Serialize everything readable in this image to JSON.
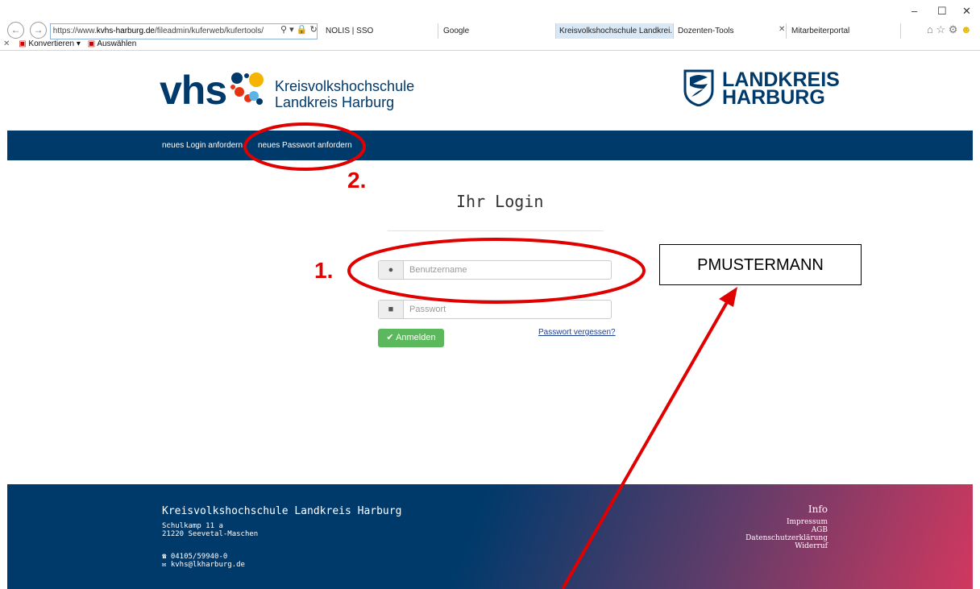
{
  "browser": {
    "url_prefix": "https://www.",
    "url_domain": "kvhs-harburg.de",
    "url_path": "/fileadmin/kuferweb/kufertools/",
    "tabs": [
      {
        "label": "NOLIS | SSO"
      },
      {
        "label": "Google"
      },
      {
        "label": "Kreisvolkshochschule Landkrei..."
      },
      {
        "label": "Dozenten-Tools"
      },
      {
        "label": "Mitarbeiterportal"
      }
    ],
    "toolbar": {
      "convert_label": "Konvertieren",
      "select_label": "Auswählen"
    }
  },
  "logo": {
    "vhs": "vhs",
    "line1": "Kreisvolkshochschule",
    "line2": "Landkreis Harburg"
  },
  "county_logo": {
    "line1": "LANDKREIS",
    "line2": "HARBURG"
  },
  "nav": {
    "login_request": "neues Login anfordern",
    "password_request": "neues Passwort anfordern"
  },
  "login": {
    "title": "Ihr Login",
    "username_placeholder": "Benutzername",
    "password_placeholder": "Passwort",
    "submit_label": "Anmelden",
    "forgot_label": "Passwort vergessen?"
  },
  "annotations": {
    "step1": "1.",
    "step2": "2.",
    "callout": "PMUSTERMANN"
  },
  "footer": {
    "org": "Kreisvolkshochschule Landkreis Harburg",
    "street": "Schulkamp 11 a",
    "city": "21220 Seevetal-Maschen",
    "phone": "04105/59940-0",
    "email": "kvhs@lkharburg.de",
    "info_title": "Info",
    "links": [
      "Impressum",
      "AGB",
      "Datenschutzerklärung",
      "Widerruf"
    ]
  },
  "colors": {
    "brand": "#003a6b",
    "accent_red": "#e00000",
    "button_green": "#5cb85c"
  }
}
